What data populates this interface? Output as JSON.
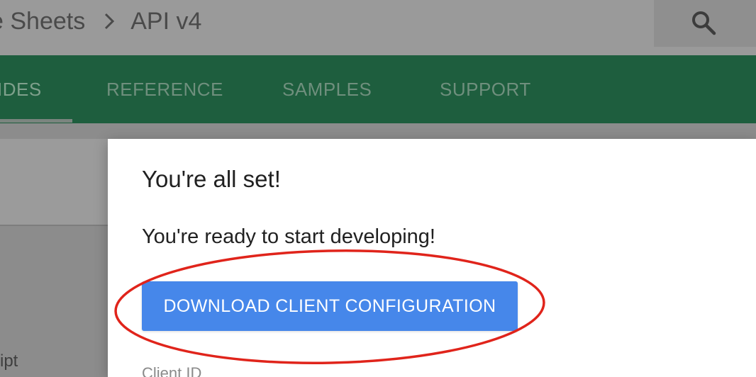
{
  "header": {
    "breadcrumb": {
      "section": "e Sheets",
      "page": "API v4"
    },
    "search_icon": "search-icon",
    "separator_icon": "chevron-right-icon"
  },
  "tabs": [
    {
      "label": "IDES",
      "active": true
    },
    {
      "label": "REFERENCE",
      "active": false
    },
    {
      "label": "SAMPLES",
      "active": false
    },
    {
      "label": "SUPPORT",
      "active": false
    }
  ],
  "side": {
    "partial_text": "ript"
  },
  "dialog": {
    "title": "You're all set!",
    "message": "You're ready to start developing!",
    "download_label": "DOWNLOAD CLIENT CONFIGURATION",
    "client_id_label": "Client ID"
  },
  "colors": {
    "tab_bar": "#1e5e3e",
    "button": "#4687ea",
    "annotation": "#e0241b",
    "overlay": "#8c8c8c"
  }
}
